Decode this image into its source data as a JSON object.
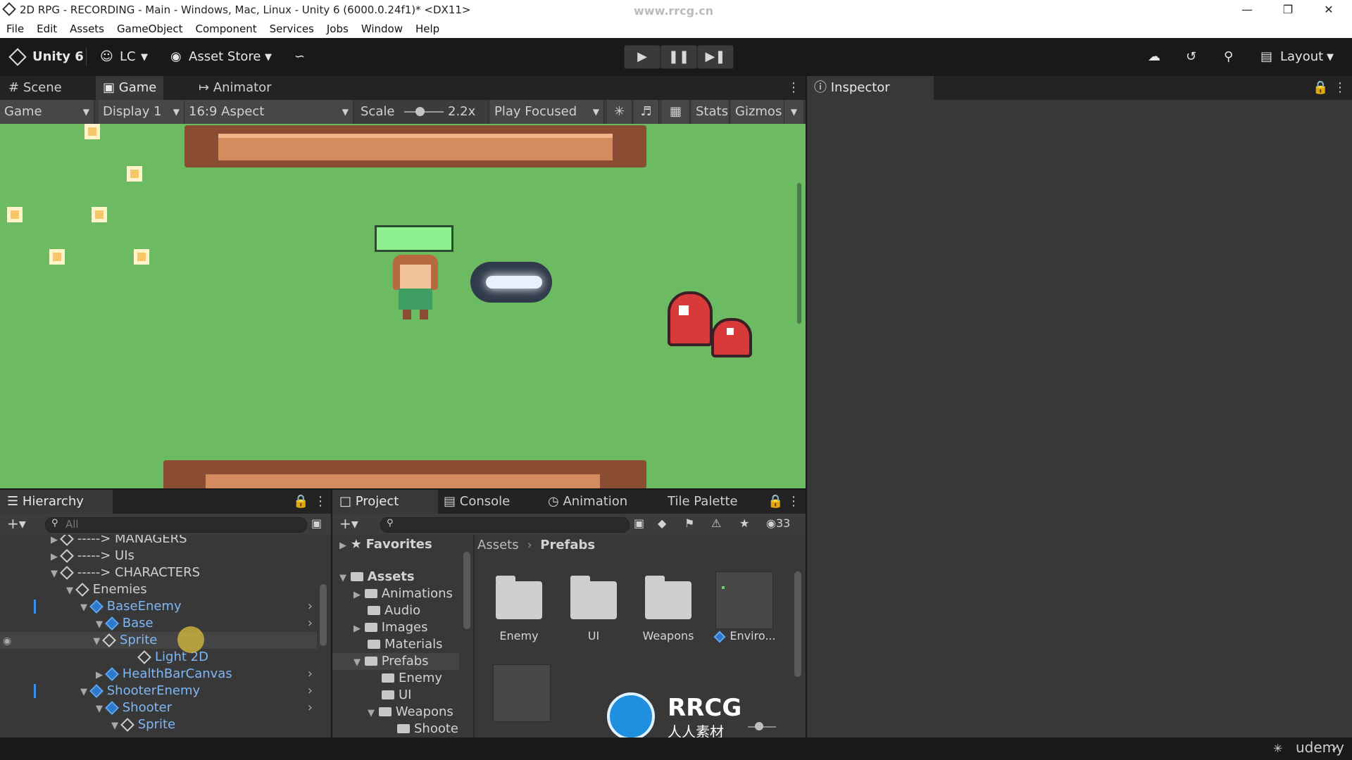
{
  "window": {
    "title": "2D RPG - RECORDING - Main - Windows, Mac, Linux - Unity 6 (6000.0.24f1)* <DX11>",
    "watermark": "www.rrcg.cn"
  },
  "menu": [
    "File",
    "Edit",
    "Assets",
    "GameObject",
    "Component",
    "Services",
    "Jobs",
    "Window",
    "Help"
  ],
  "toolbar": {
    "brand": "Unity 6",
    "account": "LC",
    "asset_store": "Asset Store",
    "layout": "Layout"
  },
  "scene_tabs": [
    "Scene",
    "Game",
    "Animator"
  ],
  "game_toolbar": {
    "view": "Game",
    "display": "Display 1",
    "aspect": "16:9 Aspect",
    "scale_label": "Scale",
    "scale_value": "2.2x",
    "play_mode": "Play Focused",
    "stats": "Stats",
    "gizmos": "Gizmos"
  },
  "inspector": {
    "tab": "Inspector"
  },
  "hierarchy": {
    "tab": "Hierarchy",
    "search_placeholder": "All",
    "rows": [
      {
        "label": "-----> MANAGERS",
        "color": "gray"
      },
      {
        "label": "-----> UIs",
        "color": "gray"
      },
      {
        "label": "-----> CHARACTERS",
        "color": "gray"
      },
      {
        "label": "Enemies",
        "color": "gray"
      },
      {
        "label": "BaseEnemy",
        "color": "blue"
      },
      {
        "label": "Base",
        "color": "blue"
      },
      {
        "label": "Sprite",
        "color": "blue"
      },
      {
        "label": "Light 2D",
        "color": "blue"
      },
      {
        "label": "HealthBarCanvas",
        "color": "blue"
      },
      {
        "label": "ShooterEnemy",
        "color": "blue"
      },
      {
        "label": "Shooter",
        "color": "blue"
      },
      {
        "label": "Sprite",
        "color": "blue"
      }
    ]
  },
  "project": {
    "tabs": [
      "Project",
      "Console",
      "Animation",
      "Tile Palette"
    ],
    "hidden_count": "33",
    "breadcrumb": [
      "Assets",
      "Prefabs"
    ],
    "tree": [
      {
        "label": "Favorites"
      },
      {
        "label": "Assets"
      },
      {
        "label": "Animations"
      },
      {
        "label": "Audio"
      },
      {
        "label": "Images"
      },
      {
        "label": "Materials"
      },
      {
        "label": "Prefabs"
      },
      {
        "label": "Enemy"
      },
      {
        "label": "UI"
      },
      {
        "label": "Weapons"
      },
      {
        "label": "Shoote"
      }
    ],
    "assets": [
      "Enemy",
      "UI",
      "Weapons",
      "Enviro..."
    ]
  },
  "overlay": {
    "logo_text": "RRCG",
    "logo_sub": "人人素材"
  },
  "status": {
    "udemy": "udemy"
  }
}
